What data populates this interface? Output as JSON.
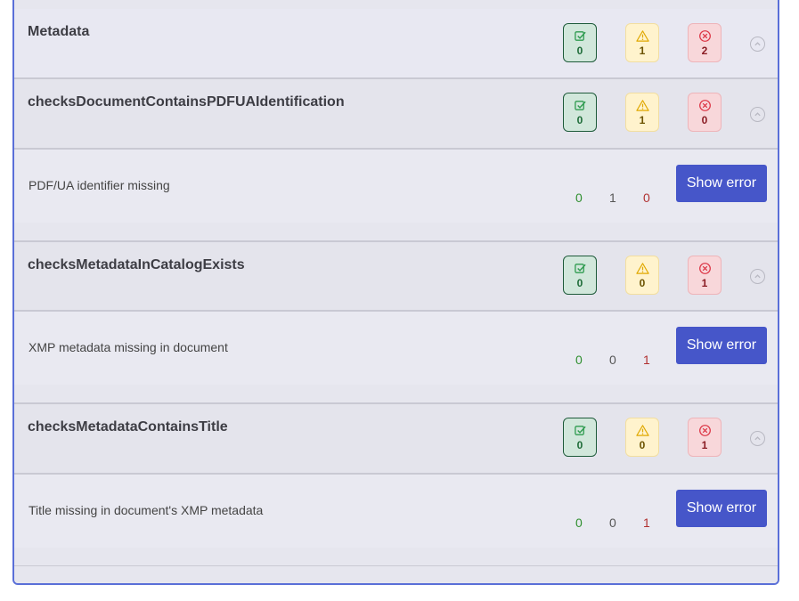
{
  "sections": [
    {
      "title": "Metadata",
      "ok": "0",
      "warn": "1",
      "err": "2"
    },
    {
      "title": "checksDocumentContainsPDFUAIdentification",
      "ok": "0",
      "warn": "1",
      "err": "0",
      "detail": {
        "message": "PDF/UA identifier missing",
        "ok": "0",
        "warn": "1",
        "err": "0",
        "button": "Show error"
      }
    },
    {
      "title": "checksMetadataInCatalogExists",
      "ok": "0",
      "warn": "0",
      "err": "1",
      "detail": {
        "message": "XMP metadata missing in document",
        "ok": "0",
        "warn": "0",
        "err": "1",
        "button": "Show error"
      }
    },
    {
      "title": "checksMetadataContainsTitle",
      "ok": "0",
      "warn": "0",
      "err": "1",
      "detail": {
        "message": "Title missing in document's XMP metadata",
        "ok": "0",
        "warn": "0",
        "err": "1",
        "button": "Show error"
      }
    }
  ],
  "icons": {
    "ok": "check-square-icon",
    "warn": "warning-triangle-icon",
    "err": "x-circle-icon",
    "toggle": "chevron-up-icon"
  },
  "colors": {
    "ok": "#1d6b37",
    "warn": "#e0a800",
    "err": "#dc3545",
    "button": "#4656c9",
    "border": "#5a6fd8"
  }
}
